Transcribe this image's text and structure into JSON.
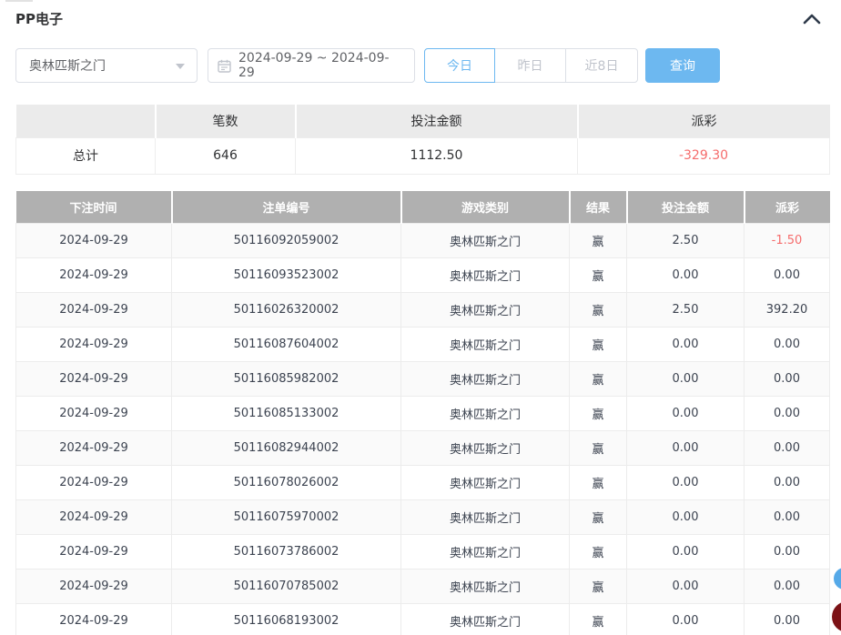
{
  "panel": {
    "title": "PP电子"
  },
  "filters": {
    "game_select": {
      "value": "奥林匹斯之门"
    },
    "date_range": {
      "value": "2024-09-29 ~ 2024-09-29"
    },
    "quick_buttons": [
      {
        "label": "今日",
        "active": true
      },
      {
        "label": "昨日",
        "active": false
      },
      {
        "label": "近8日",
        "active": false
      }
    ],
    "search_label": "查询"
  },
  "summary": {
    "headers": [
      "",
      "笔数",
      "投注金额",
      "派彩"
    ],
    "total_label": "总计",
    "count": "646",
    "bet_amount": "1112.50",
    "payout": "-329.30"
  },
  "records": {
    "headers": [
      "下注时间",
      "注单编号",
      "游戏类别",
      "结果",
      "投注金额",
      "派彩"
    ],
    "rows": [
      [
        "2024-09-29",
        "50116092059002",
        "奥林匹斯之门",
        "赢",
        "2.50",
        "-1.50"
      ],
      [
        "2024-09-29",
        "50116093523002",
        "奥林匹斯之门",
        "赢",
        "0.00",
        "0.00"
      ],
      [
        "2024-09-29",
        "50116026320002",
        "奥林匹斯之门",
        "赢",
        "2.50",
        "392.20"
      ],
      [
        "2024-09-29",
        "50116087604002",
        "奥林匹斯之门",
        "赢",
        "0.00",
        "0.00"
      ],
      [
        "2024-09-29",
        "50116085982002",
        "奥林匹斯之门",
        "赢",
        "0.00",
        "0.00"
      ],
      [
        "2024-09-29",
        "50116085133002",
        "奥林匹斯之门",
        "赢",
        "0.00",
        "0.00"
      ],
      [
        "2024-09-29",
        "50116082944002",
        "奥林匹斯之门",
        "赢",
        "0.00",
        "0.00"
      ],
      [
        "2024-09-29",
        "50116078026002",
        "奥林匹斯之门",
        "赢",
        "0.00",
        "0.00"
      ],
      [
        "2024-09-29",
        "50116075970002",
        "奥林匹斯之门",
        "赢",
        "0.00",
        "0.00"
      ],
      [
        "2024-09-29",
        "50116073786002",
        "奥林匹斯之门",
        "赢",
        "0.00",
        "0.00"
      ],
      [
        "2024-09-29",
        "50116070785002",
        "奥林匹斯之门",
        "赢",
        "0.00",
        "0.00"
      ],
      [
        "2024-09-29",
        "50116068193002",
        "奥林匹斯之门",
        "赢",
        "0.00",
        "0.00"
      ]
    ]
  },
  "colors": {
    "accent_blue": "#6db8f0",
    "negative_red": "#f56c6c",
    "records_header_bg": "#b0b0b0",
    "summary_header_bg": "#ebebeb"
  }
}
